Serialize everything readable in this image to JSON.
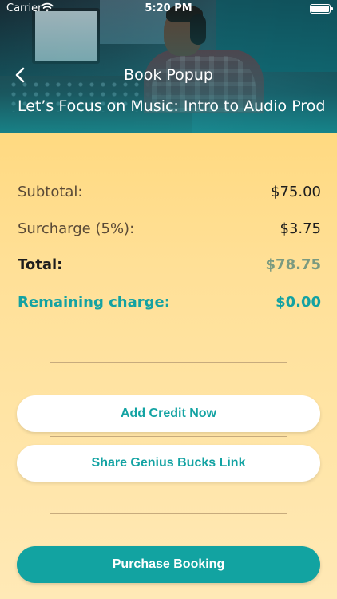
{
  "status_bar": {
    "carrier": "Carrier",
    "time": "5:20 PM"
  },
  "nav": {
    "title": "Book Popup",
    "back_icon": "chevron-left-icon"
  },
  "event": {
    "title": "Let’s Focus on Music: Intro to Audio Prod"
  },
  "summary": {
    "subtotal_label": "Subtotal:",
    "subtotal_value": "$75.00",
    "surcharge_label": "Surcharge (5%):",
    "surcharge_value": "$3.75",
    "total_label": "Total:",
    "total_value": "$78.75",
    "remaining_label": "Remaining charge:",
    "remaining_value": "$0.00"
  },
  "buttons": {
    "add_credit": "Add Credit Now",
    "share_link": "Share Genius Bucks Link",
    "purchase": "Purchase Booking"
  },
  "colors": {
    "accent": "#12a3a1",
    "background_top": "#ffd36b",
    "background_bottom": "#ffe9b6",
    "total_value": "#7a9a80"
  }
}
